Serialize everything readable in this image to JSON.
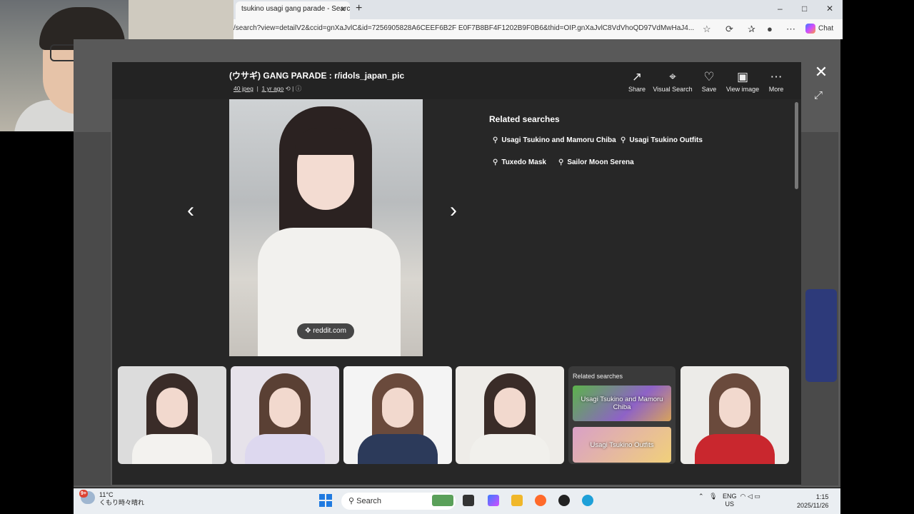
{
  "browser": {
    "tab_title": "tsukino usagi gang parade - Search",
    "new_tab": "+",
    "window_controls": {
      "minimize": "–",
      "maximize": "□",
      "close": "✕"
    },
    "url": "/search?view=detailV2&ccid=gnXaJvlC&id=7256905828A6CEEF6B2F E0F7B8BF4F1202B9F0B6&thid=OIP.gnXaJvlC8VdVhoQD97VdMwHaJ4...",
    "chat_label": "Chat"
  },
  "viewer": {
    "title": "(ウサギ) GANG PARADE : r/idols_japan_pic",
    "meta_file": "40 jpeg",
    "meta_time": "1 yr ago",
    "actions": [
      {
        "label": "Share",
        "icon": "share-icon"
      },
      {
        "label": "Visual Search",
        "icon": "visual-search-icon"
      },
      {
        "label": "Save",
        "icon": "save-icon"
      },
      {
        "label": "View image",
        "icon": "view-image-icon"
      },
      {
        "label": "More",
        "icon": "more-icon"
      }
    ],
    "source_badge": "reddit.com",
    "related_title": "Related searches",
    "related": [
      "Usagi Tsukino and Mamoru Chiba",
      "Usagi Tsukino Outfits",
      "Tuxedo Mask",
      "Sailor Moon Serena"
    ],
    "strip_related_title": "Related searches",
    "strip_related": [
      "Usagi Tsukino and Mamoru Chiba",
      "Usagi Tsukino Outfits"
    ]
  },
  "taskbar": {
    "weather_temp": "11°C",
    "weather_desc": "くもり時々晴れ",
    "weather_badge": "9+",
    "search_label": "Search",
    "lang_top": "ENG",
    "lang_bottom": "US",
    "time": "1:15",
    "date": "2025/11/26"
  }
}
